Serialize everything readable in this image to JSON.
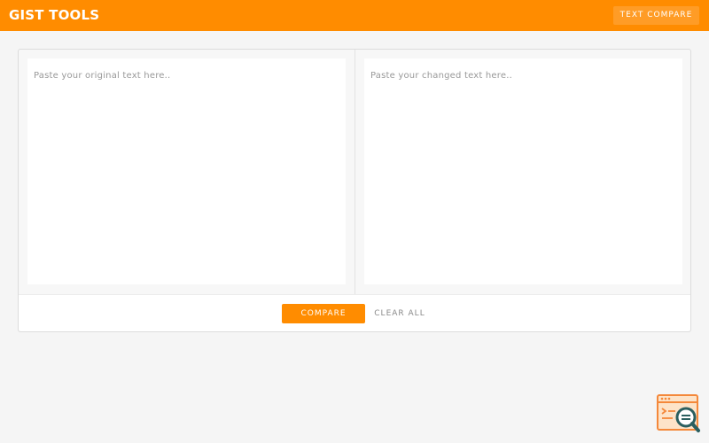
{
  "header": {
    "brand": "GIST TOOLS",
    "nav_button": "TEXT COMPARE"
  },
  "editors": {
    "original_placeholder": "Paste your original text here..",
    "changed_placeholder": "Paste your changed text here.."
  },
  "actions": {
    "compare_label": "COMPARE",
    "clear_label": "CLEAR ALL"
  },
  "colors": {
    "accent": "#ff8c00",
    "background": "#f5f5f5"
  },
  "icons": {
    "widget": "search-document-icon"
  }
}
